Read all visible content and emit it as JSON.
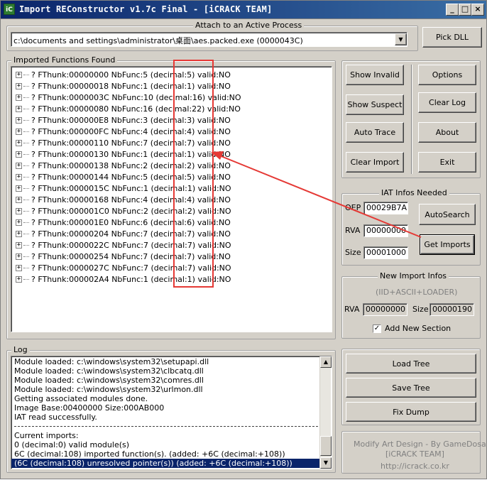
{
  "window": {
    "title": "Import REConstructor v1.7c Final - [iCRACK TEAM]",
    "icon_text": "iC",
    "controls": {
      "minimize": "_",
      "maximize": "□",
      "close": "×"
    }
  },
  "attach": {
    "label": "Attach to an Active Process",
    "process_value": "c:\\documents and settings\\administrator\\桌面\\aes.packed.exe (0000043C)",
    "dropdown_icon": "chevron-down-icon",
    "pick_dll": "Pick DLL"
  },
  "imports": {
    "label": "Imported Functions Found",
    "rows": [
      {
        "text": "? FThunk:00000000 NbFunc:5 (decimal:5) valid:NO"
      },
      {
        "text": "? FThunk:00000018 NbFunc:1 (decimal:1) valid:NO"
      },
      {
        "text": "? FThunk:0000003C NbFunc:10 (decimal:16) valid:NO"
      },
      {
        "text": "? FThunk:00000080 NbFunc:16 (decimal:22) valid:NO"
      },
      {
        "text": "? FThunk:000000E8 NbFunc:3 (decimal:3) valid:NO"
      },
      {
        "text": "? FThunk:000000FC NbFunc:4 (decimal:4) valid:NO"
      },
      {
        "text": "? FThunk:00000110 NbFunc:7 (decimal:7) valid:NO"
      },
      {
        "text": "? FThunk:00000130 NbFunc:1 (decimal:1) valid:NO"
      },
      {
        "text": "? FThunk:00000138 NbFunc:2 (decimal:2) valid:NO"
      },
      {
        "text": "? FThunk:00000144 NbFunc:5 (decimal:5) valid:NO"
      },
      {
        "text": "? FThunk:0000015C NbFunc:1 (decimal:1) valid:NO"
      },
      {
        "text": "? FThunk:00000168 NbFunc:4 (decimal:4) valid:NO"
      },
      {
        "text": "? FThunk:000001C0 NbFunc:2 (decimal:2) valid:NO"
      },
      {
        "text": "? FThunk:000001E0 NbFunc:6 (decimal:6) valid:NO"
      },
      {
        "text": "? FThunk:00000204 NbFunc:7 (decimal:7) valid:NO"
      },
      {
        "text": "? FThunk:0000022C NbFunc:7 (decimal:7) valid:NO"
      },
      {
        "text": "? FThunk:00000254 NbFunc:7 (decimal:7) valid:NO"
      },
      {
        "text": "? FThunk:0000027C NbFunc:7 (decimal:7) valid:NO"
      },
      {
        "text": "? FThunk:000002A4 NbFunc:1 (decimal:1) valid:NO"
      }
    ],
    "expand_glyph": "+",
    "highlight_color": "#e53935"
  },
  "buttons": {
    "show_invalid": "Show Invalid",
    "show_suspect": "Show Suspect",
    "auto_trace": "Auto Trace",
    "clear_import": "Clear Import",
    "options": "Options",
    "clear_log": "Clear Log",
    "about": "About",
    "exit": "Exit"
  },
  "iat": {
    "label": "IAT Infos Needed",
    "oep_label": "OEP",
    "oep_value": "00029B7A",
    "rva_label": "RVA",
    "rva_value": "00000000",
    "size_label": "Size",
    "size_value": "00001000",
    "autosearch": "AutoSearch",
    "get_imports": "Get Imports"
  },
  "new_import": {
    "label": "New Import Infos",
    "subtitle": "(IID+ASCII+LOADER)",
    "rva_label": "RVA",
    "rva_value": "00000000",
    "size_label": "Size",
    "size_value": "00000190",
    "add_section_label": "Add New Section",
    "add_section_checked": true
  },
  "log": {
    "label": "Log",
    "lines": [
      "Module loaded: c:\\windows\\system32\\setupapi.dll",
      "Module loaded: c:\\windows\\system32\\clbcatq.dll",
      "Module loaded: c:\\windows\\system32\\comres.dll",
      "Module loaded: c:\\windows\\system32\\urlmon.dll",
      "Getting associated modules done.",
      "Image Base:00400000 Size:000AB000",
      "IAT read successfully.",
      "",
      "Current imports:",
      "0 (decimal:0) valid module(s)",
      "6C (decimal:108) imported function(s). (added: +6C (decimal:+108))",
      "(6C (decimal:108) unresolved pointer(s)) (added: +6C (decimal:+108))"
    ],
    "selected_index": 11,
    "separator_after": 6,
    "up_arrow": "▲",
    "down_arrow": "▼"
  },
  "tree_actions": {
    "load_tree": "Load Tree",
    "save_tree": "Save Tree",
    "fix_dump": "Fix Dump"
  },
  "credits": {
    "line1": "Modify Art Design - By GameDosa",
    "line2": "[iCRACK TEAM]",
    "line3": "http://icrack.co.kr"
  }
}
